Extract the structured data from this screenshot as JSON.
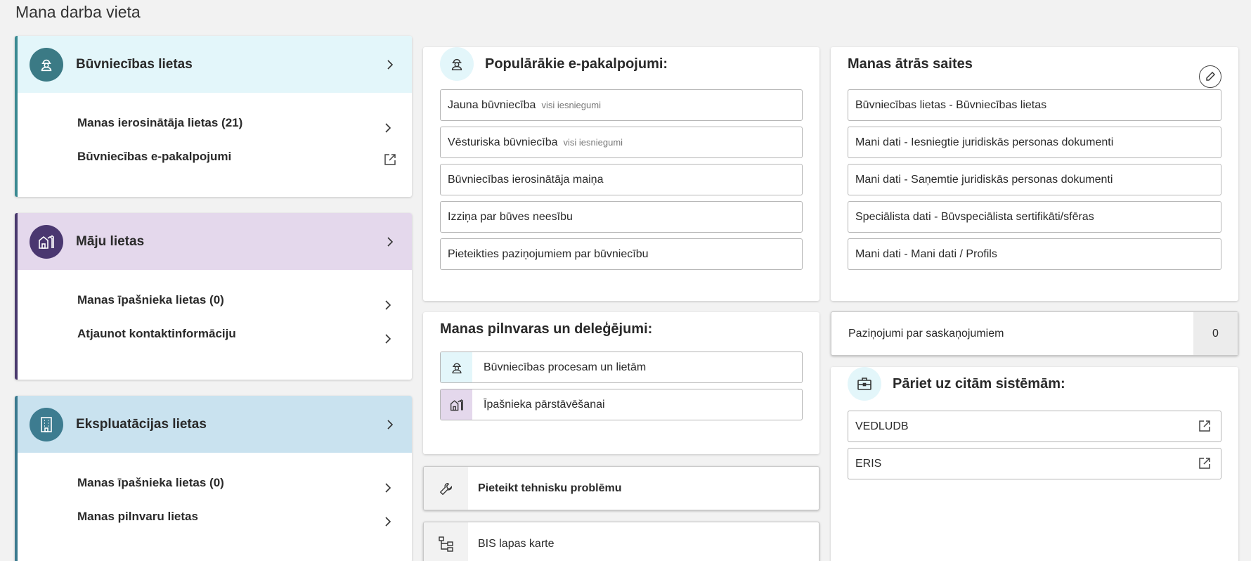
{
  "page": {
    "title": "Mana darba vieta"
  },
  "cases": {
    "build": {
      "title": "Būvniecības lietas",
      "links": [
        "Manas ierosinātāja lietas (21)",
        "Būvniecības e-pakalpojumi"
      ]
    },
    "house": {
      "title": "Māju lietas",
      "links": [
        "Manas īpašnieka lietas (0)",
        "Atjaunot kontaktinformāciju"
      ]
    },
    "exp": {
      "title": "Ekspluatācijas lietas",
      "links": [
        "Manas īpašnieka lietas (0)",
        "Manas pilnvaru lietas"
      ]
    }
  },
  "popular": {
    "title": "Populārākie e-pakalpojumi:",
    "items": [
      {
        "label": "Jauna būvniecība",
        "sub": "visi iesniegumi"
      },
      {
        "label": "Vēsturiska būvniecība",
        "sub": "visi iesniegumi"
      },
      {
        "label": "Būvniecības ierosinātāja maiņa",
        "sub": ""
      },
      {
        "label": "Izziņa par būves neesību",
        "sub": ""
      },
      {
        "label": "Pieteikties paziņojumiem par būvniecību",
        "sub": ""
      }
    ]
  },
  "delegations": {
    "title": "Manas pilnvaras un deleģējumi:",
    "items": [
      "Būvniecības procesam un lietām",
      "Īpašnieka pārstāvēšanai"
    ]
  },
  "actions": {
    "report": "Pieteikt tehnisku problēmu",
    "sitemap": "BIS lapas karte"
  },
  "quicklinks": {
    "title": "Manas ātrās saites",
    "items": [
      "Būvniecības lietas - Būvniecības lietas",
      "Mani dati - Iesniegtie juridiskās personas dokumenti",
      "Mani dati - Saņemtie juridiskās personas dokumenti",
      "Speciālista dati - Būvspeciālista sertifikāti/sfēras",
      "Mani dati - Mani dati / Profils"
    ]
  },
  "notifications": {
    "label": "Paziņojumi par saskaņojumiem",
    "count": "0"
  },
  "systems": {
    "title": "Pāriet uz citām sistēmām:",
    "items": [
      "VEDLUDB",
      "ERIS"
    ]
  }
}
